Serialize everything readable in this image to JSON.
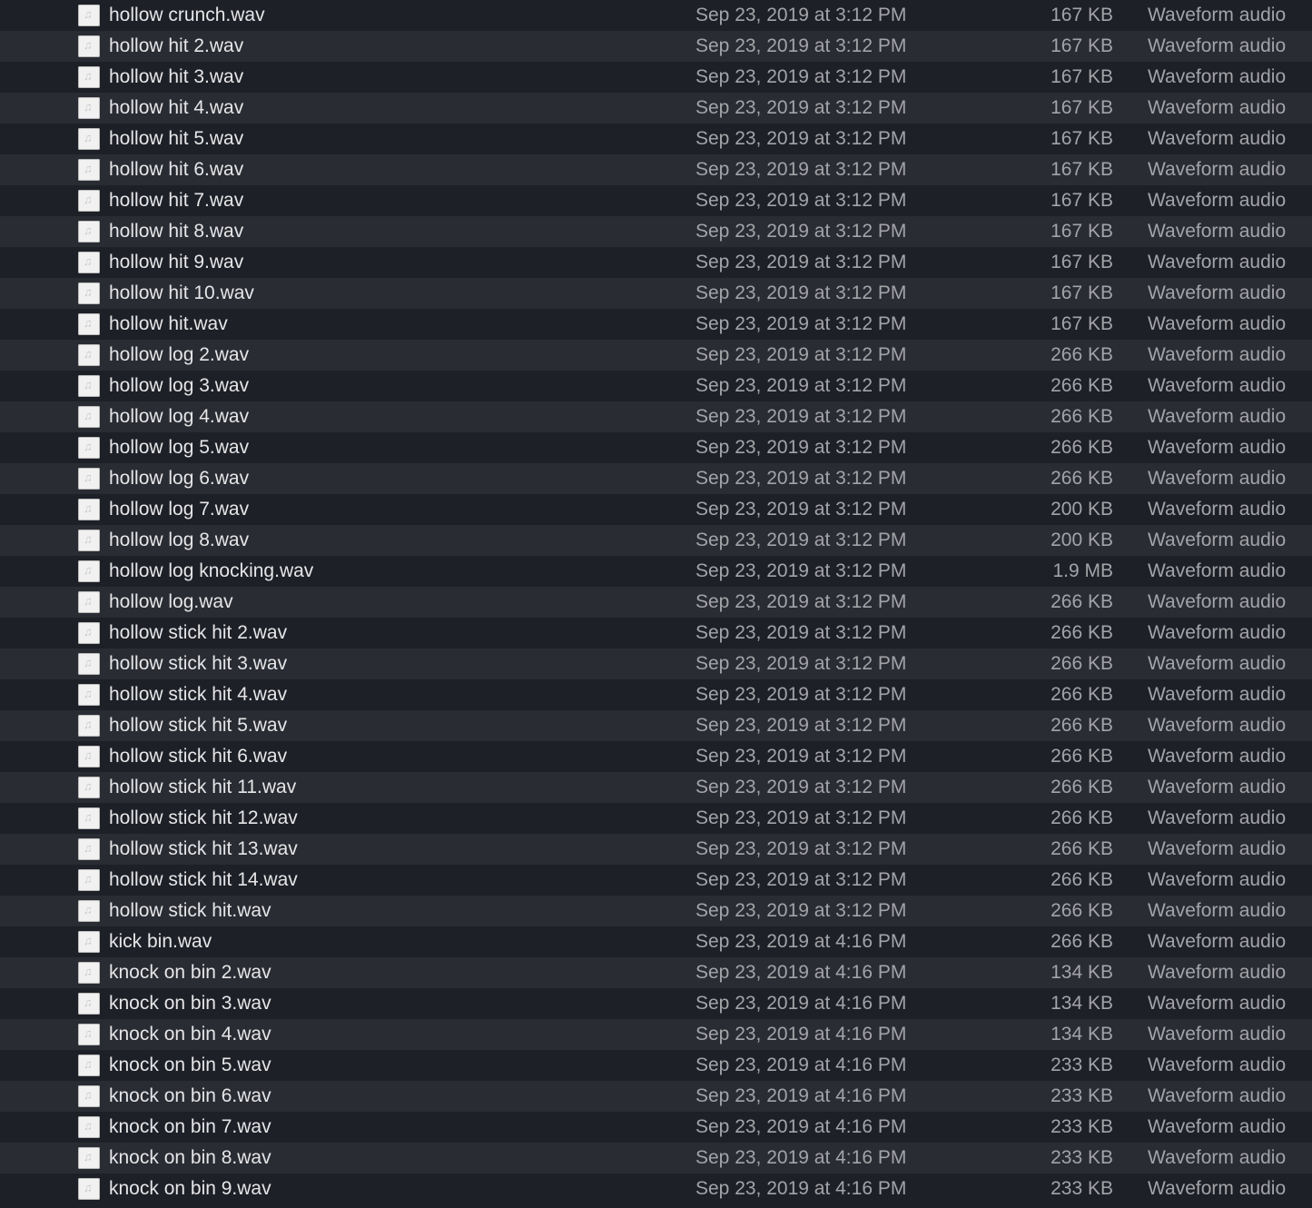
{
  "colors": {
    "row_dark": "#1e2027",
    "row_light": "#2a2c33",
    "name_text": "#e6e6e8",
    "secondary_text": "#a3a4a8"
  },
  "file_icon": "audio-file-icon",
  "files": [
    {
      "name": "hollow crunch.wav",
      "date": "Sep 23, 2019 at 3:12 PM",
      "size": "167 KB",
      "kind": "Waveform audio"
    },
    {
      "name": "hollow hit 2.wav",
      "date": "Sep 23, 2019 at 3:12 PM",
      "size": "167 KB",
      "kind": "Waveform audio"
    },
    {
      "name": "hollow hit 3.wav",
      "date": "Sep 23, 2019 at 3:12 PM",
      "size": "167 KB",
      "kind": "Waveform audio"
    },
    {
      "name": "hollow hit 4.wav",
      "date": "Sep 23, 2019 at 3:12 PM",
      "size": "167 KB",
      "kind": "Waveform audio"
    },
    {
      "name": "hollow hit 5.wav",
      "date": "Sep 23, 2019 at 3:12 PM",
      "size": "167 KB",
      "kind": "Waveform audio"
    },
    {
      "name": "hollow hit 6.wav",
      "date": "Sep 23, 2019 at 3:12 PM",
      "size": "167 KB",
      "kind": "Waveform audio"
    },
    {
      "name": "hollow hit 7.wav",
      "date": "Sep 23, 2019 at 3:12 PM",
      "size": "167 KB",
      "kind": "Waveform audio"
    },
    {
      "name": "hollow hit 8.wav",
      "date": "Sep 23, 2019 at 3:12 PM",
      "size": "167 KB",
      "kind": "Waveform audio"
    },
    {
      "name": "hollow hit 9.wav",
      "date": "Sep 23, 2019 at 3:12 PM",
      "size": "167 KB",
      "kind": "Waveform audio"
    },
    {
      "name": "hollow hit 10.wav",
      "date": "Sep 23, 2019 at 3:12 PM",
      "size": "167 KB",
      "kind": "Waveform audio"
    },
    {
      "name": "hollow hit.wav",
      "date": "Sep 23, 2019 at 3:12 PM",
      "size": "167 KB",
      "kind": "Waveform audio"
    },
    {
      "name": "hollow log 2.wav",
      "date": "Sep 23, 2019 at 3:12 PM",
      "size": "266 KB",
      "kind": "Waveform audio"
    },
    {
      "name": "hollow log 3.wav",
      "date": "Sep 23, 2019 at 3:12 PM",
      "size": "266 KB",
      "kind": "Waveform audio"
    },
    {
      "name": "hollow log 4.wav",
      "date": "Sep 23, 2019 at 3:12 PM",
      "size": "266 KB",
      "kind": "Waveform audio"
    },
    {
      "name": "hollow log 5.wav",
      "date": "Sep 23, 2019 at 3:12 PM",
      "size": "266 KB",
      "kind": "Waveform audio"
    },
    {
      "name": "hollow log 6.wav",
      "date": "Sep 23, 2019 at 3:12 PM",
      "size": "266 KB",
      "kind": "Waveform audio"
    },
    {
      "name": "hollow log 7.wav",
      "date": "Sep 23, 2019 at 3:12 PM",
      "size": "200 KB",
      "kind": "Waveform audio"
    },
    {
      "name": "hollow log 8.wav",
      "date": "Sep 23, 2019 at 3:12 PM",
      "size": "200 KB",
      "kind": "Waveform audio"
    },
    {
      "name": "hollow log knocking.wav",
      "date": "Sep 23, 2019 at 3:12 PM",
      "size": "1.9 MB",
      "kind": "Waveform audio"
    },
    {
      "name": "hollow log.wav",
      "date": "Sep 23, 2019 at 3:12 PM",
      "size": "266 KB",
      "kind": "Waveform audio"
    },
    {
      "name": "hollow stick hit 2.wav",
      "date": "Sep 23, 2019 at 3:12 PM",
      "size": "266 KB",
      "kind": "Waveform audio"
    },
    {
      "name": "hollow stick hit 3.wav",
      "date": "Sep 23, 2019 at 3:12 PM",
      "size": "266 KB",
      "kind": "Waveform audio"
    },
    {
      "name": "hollow stick hit 4.wav",
      "date": "Sep 23, 2019 at 3:12 PM",
      "size": "266 KB",
      "kind": "Waveform audio"
    },
    {
      "name": "hollow stick hit 5.wav",
      "date": "Sep 23, 2019 at 3:12 PM",
      "size": "266 KB",
      "kind": "Waveform audio"
    },
    {
      "name": "hollow stick hit 6.wav",
      "date": "Sep 23, 2019 at 3:12 PM",
      "size": "266 KB",
      "kind": "Waveform audio"
    },
    {
      "name": "hollow stick hit 11.wav",
      "date": "Sep 23, 2019 at 3:12 PM",
      "size": "266 KB",
      "kind": "Waveform audio"
    },
    {
      "name": "hollow stick hit 12.wav",
      "date": "Sep 23, 2019 at 3:12 PM",
      "size": "266 KB",
      "kind": "Waveform audio"
    },
    {
      "name": "hollow stick hit 13.wav",
      "date": "Sep 23, 2019 at 3:12 PM",
      "size": "266 KB",
      "kind": "Waveform audio"
    },
    {
      "name": "hollow stick hit 14.wav",
      "date": "Sep 23, 2019 at 3:12 PM",
      "size": "266 KB",
      "kind": "Waveform audio"
    },
    {
      "name": "hollow stick hit.wav",
      "date": "Sep 23, 2019 at 3:12 PM",
      "size": "266 KB",
      "kind": "Waveform audio"
    },
    {
      "name": "kick bin.wav",
      "date": "Sep 23, 2019 at 4:16 PM",
      "size": "266 KB",
      "kind": "Waveform audio"
    },
    {
      "name": "knock on bin 2.wav",
      "date": "Sep 23, 2019 at 4:16 PM",
      "size": "134 KB",
      "kind": "Waveform audio"
    },
    {
      "name": "knock on bin 3.wav",
      "date": "Sep 23, 2019 at 4:16 PM",
      "size": "134 KB",
      "kind": "Waveform audio"
    },
    {
      "name": "knock on bin 4.wav",
      "date": "Sep 23, 2019 at 4:16 PM",
      "size": "134 KB",
      "kind": "Waveform audio"
    },
    {
      "name": "knock on bin 5.wav",
      "date": "Sep 23, 2019 at 4:16 PM",
      "size": "233 KB",
      "kind": "Waveform audio"
    },
    {
      "name": "knock on bin 6.wav",
      "date": "Sep 23, 2019 at 4:16 PM",
      "size": "233 KB",
      "kind": "Waveform audio"
    },
    {
      "name": "knock on bin 7.wav",
      "date": "Sep 23, 2019 at 4:16 PM",
      "size": "233 KB",
      "kind": "Waveform audio"
    },
    {
      "name": "knock on bin 8.wav",
      "date": "Sep 23, 2019 at 4:16 PM",
      "size": "233 KB",
      "kind": "Waveform audio"
    },
    {
      "name": "knock on bin 9.wav",
      "date": "Sep 23, 2019 at 4:16 PM",
      "size": "233 KB",
      "kind": "Waveform audio"
    }
  ]
}
